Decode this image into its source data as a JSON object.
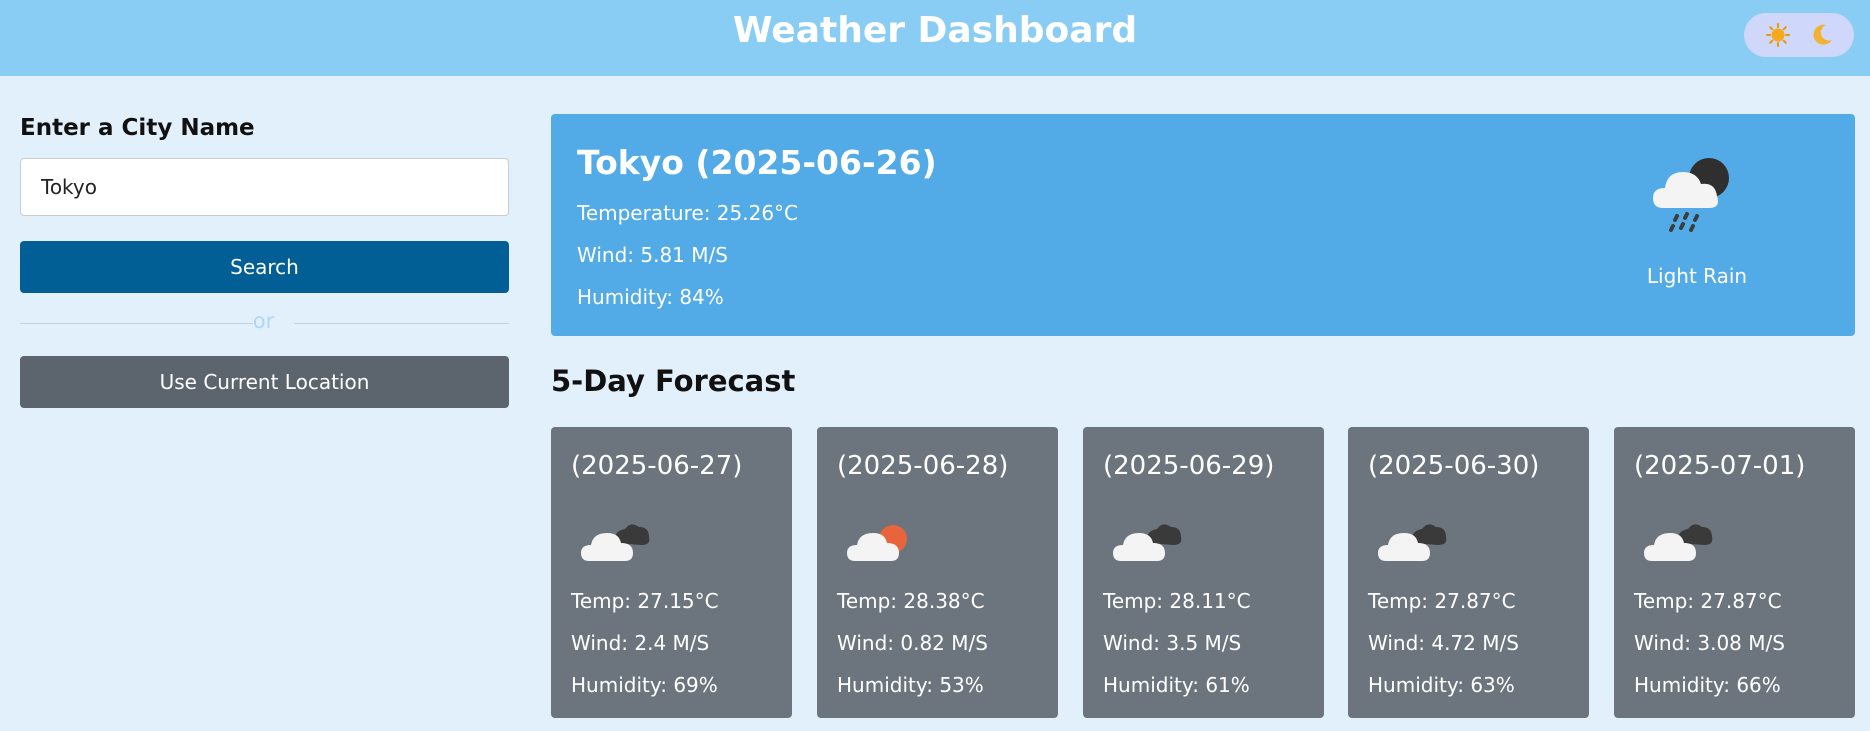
{
  "header": {
    "title": "Weather Dashboard",
    "theme_toggle": {
      "light_icon": "sun-icon",
      "dark_icon": "moon-icon"
    }
  },
  "search": {
    "label": "Enter a City Name",
    "input_value": "Tokyo",
    "search_button": "Search",
    "divider_text": "or",
    "location_button": "Use Current Location"
  },
  "current": {
    "title": "Tokyo (2025-06-26)",
    "temperature": "Temperature: 25.26°C",
    "wind": "Wind: 5.81 M/S",
    "humidity": "Humidity: 84%",
    "icon": "night-rain-icon",
    "description": "Light Rain"
  },
  "forecast": {
    "title": "5-Day Forecast",
    "days": [
      {
        "date": "(2025-06-27)",
        "icon": "broken-clouds-icon",
        "temp": "Temp: 27.15°C",
        "wind": "Wind: 2.4 M/S",
        "humidity": "Humidity: 69%"
      },
      {
        "date": "(2025-06-28)",
        "icon": "few-clouds-icon",
        "temp": "Temp: 28.38°C",
        "wind": "Wind: 0.82 M/S",
        "humidity": "Humidity: 53%"
      },
      {
        "date": "(2025-06-29)",
        "icon": "broken-clouds-icon",
        "temp": "Temp: 28.11°C",
        "wind": "Wind: 3.5 M/S",
        "humidity": "Humidity: 61%"
      },
      {
        "date": "(2025-06-30)",
        "icon": "broken-clouds-icon",
        "temp": "Temp: 27.87°C",
        "wind": "Wind: 4.72 M/S",
        "humidity": "Humidity: 63%"
      },
      {
        "date": "(2025-07-01)",
        "icon": "broken-clouds-icon",
        "temp": "Temp: 27.87°C",
        "wind": "Wind: 3.08 M/S",
        "humidity": "Humidity: 66%"
      }
    ]
  },
  "colors": {
    "header_bg": "#8acdf4",
    "page_bg": "#e2f0fc",
    "current_card_bg": "#52abe7",
    "forecast_card_bg": "#6c757e",
    "search_button_bg": "#015f95",
    "location_button_bg": "#5c646e"
  }
}
